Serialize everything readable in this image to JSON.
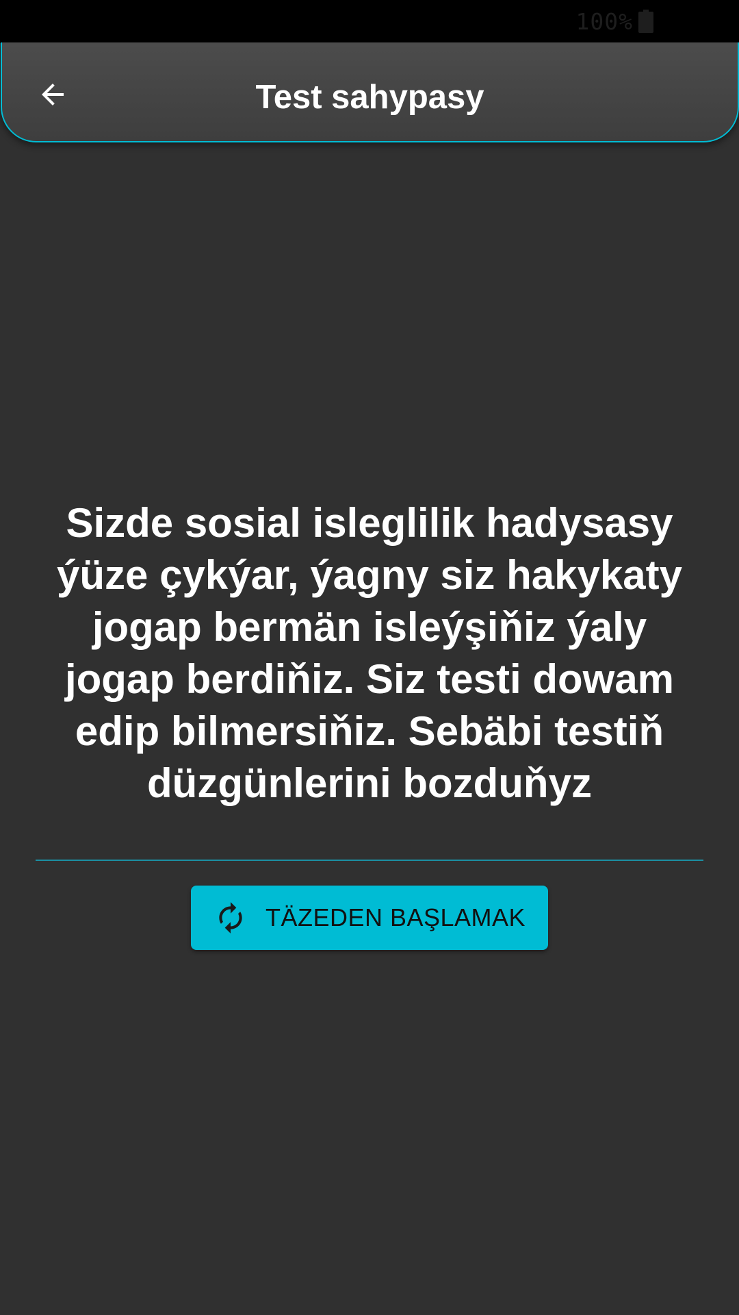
{
  "status_bar": {
    "battery_text": "100%",
    "battery_icon": "battery-full-icon"
  },
  "app_bar": {
    "title": "Test sahypasy",
    "back_icon": "arrow-back-icon"
  },
  "main": {
    "message": "Sizde sosial isleglilik hadysasy ýüze çykýar, ýagny siz hakykaty jogap bermän  isleýşiňiz ýaly jogap berdiňiz. Siz testi dowam edip bilmersiňiz. Sebäbi testiň düzgünlerini bozduňyz",
    "restart_button": {
      "label": "TÄZEDEN BAŞLAMAK",
      "icon": "restart-icon"
    }
  },
  "colors": {
    "background": "#303030",
    "accent": "#00bcd4",
    "app_bar": "#454545",
    "text": "#ffffff"
  }
}
